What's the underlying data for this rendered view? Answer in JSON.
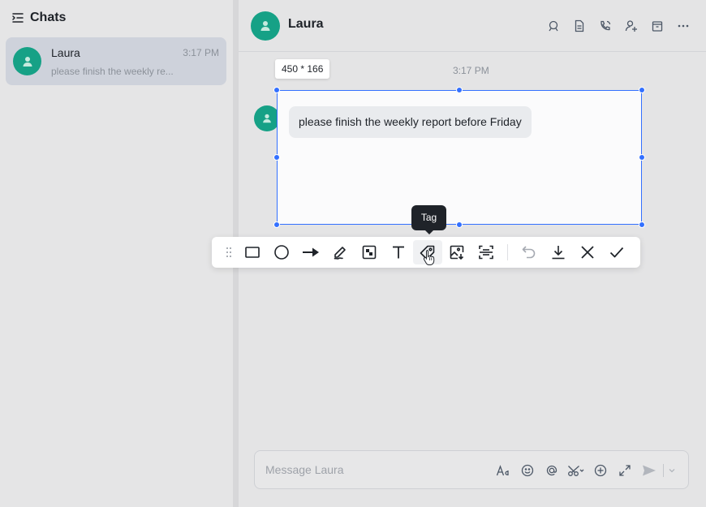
{
  "sidebar": {
    "title": "Chats",
    "chats": [
      {
        "name": "Laura",
        "time": "3:17 PM",
        "preview": "please finish the weekly re..."
      }
    ]
  },
  "conversation": {
    "title": "Laura",
    "header_actions": [
      "search-chat-icon",
      "document-icon",
      "call-icon",
      "add-member-icon",
      "calendar-icon",
      "more-icon"
    ],
    "timestamp": "3:17 PM",
    "messages": [
      {
        "text": "please finish the weekly report before Friday"
      }
    ]
  },
  "composer": {
    "placeholder": "Message Laura",
    "tools": [
      "text-format-icon",
      "emoji-icon",
      "mention-icon",
      "screenshot-icon",
      "add-icon",
      "expand-icon",
      "send-icon",
      "send-options-icon"
    ]
  },
  "screenshot": {
    "size_label": "450 * 166",
    "tooltip": "Tag",
    "tools": [
      {
        "name": "drag-handle-icon",
        "label": "Drag"
      },
      {
        "name": "rectangle-icon",
        "label": "Rectangle"
      },
      {
        "name": "ellipse-icon",
        "label": "Ellipse"
      },
      {
        "name": "arrow-icon",
        "label": "Arrow"
      },
      {
        "name": "pen-icon",
        "label": "Pen"
      },
      {
        "name": "mosaic-icon",
        "label": "Mosaic"
      },
      {
        "name": "text-icon",
        "label": "Text"
      },
      {
        "name": "tag-icon",
        "label": "Tag"
      },
      {
        "name": "image-save-icon",
        "label": "Pin image"
      },
      {
        "name": "ocr-icon",
        "label": "Extract text"
      },
      {
        "name": "undo-icon",
        "label": "Undo"
      },
      {
        "name": "download-icon",
        "label": "Download"
      },
      {
        "name": "close-icon",
        "label": "Cancel"
      },
      {
        "name": "confirm-icon",
        "label": "Done"
      }
    ]
  },
  "colors": {
    "accent": "#3370ff",
    "avatar": "#17a589"
  }
}
